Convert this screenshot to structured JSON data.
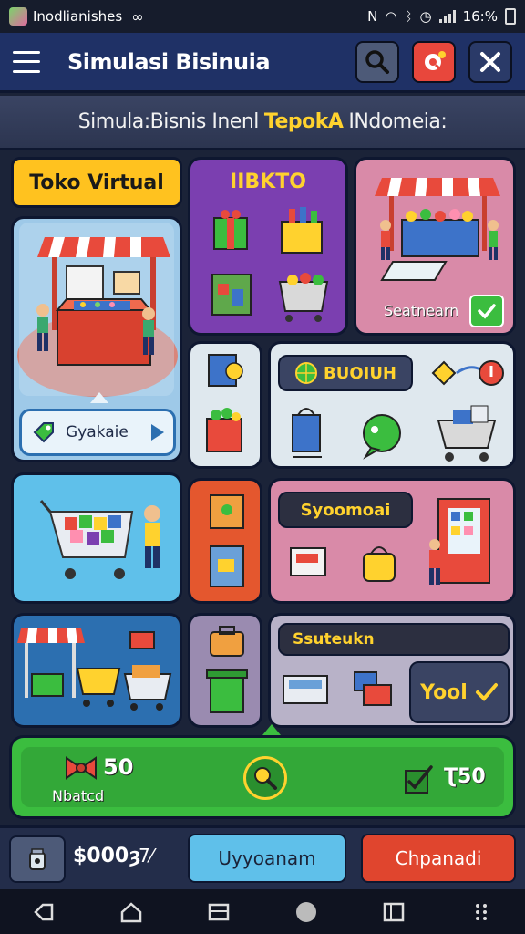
{
  "status_bar": {
    "app_name": "Inodlianishes",
    "time": "16:%"
  },
  "app_bar": {
    "title": "Simulasi Bisinuia"
  },
  "subtitle": {
    "prefix": "Simula:Bisnis Inenl",
    "highlight": "TepokA",
    "suffix": "INdomeia:"
  },
  "panels": {
    "toko_virtual": {
      "label": "Toko Virtual",
      "action_label": "Gyakaie"
    },
    "purple_panel": {
      "label": "IIBKTO"
    },
    "pink_stall": {
      "label": "Seatnearn"
    },
    "mid_panel": {
      "label": "BUOIUH"
    },
    "sy_panel": {
      "label": "Syoomoai"
    },
    "su_panel": {
      "label": "Ssuteukn",
      "action_label": "Yool"
    }
  },
  "green_bar": {
    "left_value": "50",
    "left_label": "Nbatcd",
    "right_value": "Ʈ50"
  },
  "bottom_bar": {
    "money": "$000ȝ",
    "money_suffix": "7⁄",
    "btn_blue": "Uyyoanam",
    "btn_red": "Chpanadi"
  },
  "colors": {
    "yellow": "#ffd22e",
    "purple": "#7b3fb0",
    "pink": "#d98aa8",
    "sky": "#5fc0ea",
    "orange": "#e4572e",
    "green": "#3bbd3f",
    "light": "#dfe8ee"
  }
}
